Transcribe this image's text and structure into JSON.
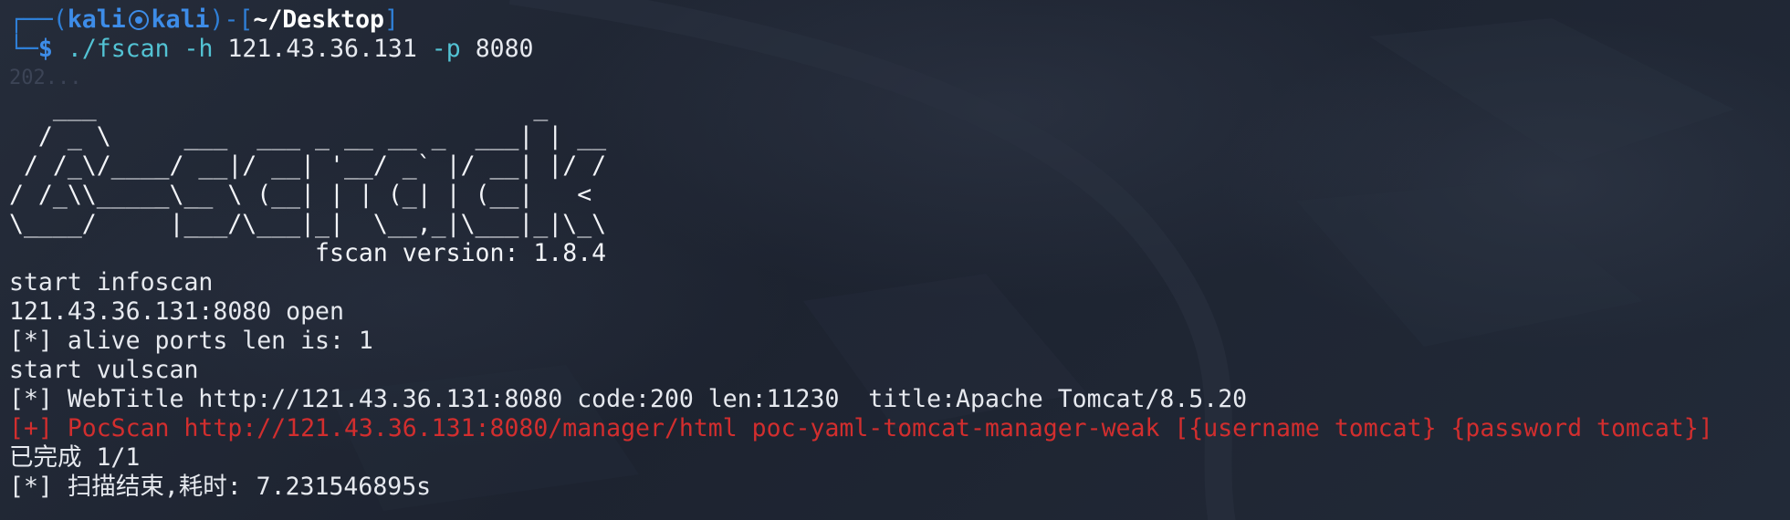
{
  "prompt": {
    "box_top": "┌──",
    "box_bottom": "└─",
    "open_paren": "(",
    "user": "kali",
    "host": "kali",
    "close_paren": ")",
    "dash_open_bracket": "-[",
    "cwd": "~/Desktop",
    "close_bracket": "]",
    "dollar": "$",
    "command": "./fscan",
    "arg1": "-h",
    "arg1_val": "121.43.36.131",
    "arg2": "-p",
    "arg2_val": "8080",
    "ghost_hint": "202..."
  },
  "ascii_art": [
    "   ___                              _",
    "  / _ \\     ___  ___ _ __ __ _  ___| | __",
    " / /_\\/____/ __|/ __| '__/ _` |/ __| |/ /",
    "/ /_\\\\_____\\__ \\ (__| | | (_| | (__|   <",
    "\\____/     |___/\\___|_|  \\__,_|\\___|_|\\_\\",
    "                     fscan version: 1.8.4"
  ],
  "output": [
    {
      "text": "start infoscan",
      "color": "#e6e9ef"
    },
    {
      "text": "121.43.36.131:8080 open",
      "color": "#e6e9ef"
    },
    {
      "text": "[*] alive ports len is: 1",
      "color": "#e6e9ef"
    },
    {
      "text": "start vulscan",
      "color": "#e6e9ef"
    },
    {
      "text": "[*] WebTitle http://121.43.36.131:8080 code:200 len:11230  title:Apache Tomcat/8.5.20",
      "color": "#e6e9ef"
    },
    {
      "text": "[+] PocScan http://121.43.36.131:8080/manager/html poc-yaml-tomcat-manager-weak [{username tomcat} {password tomcat}]",
      "color": "#d22e2e"
    },
    {
      "text": "已完成 1/1",
      "color": "#e6e9ef"
    },
    {
      "text": "[*] 扫描结束,耗时: 7.231546895s",
      "color": "#e6e9ef"
    }
  ]
}
